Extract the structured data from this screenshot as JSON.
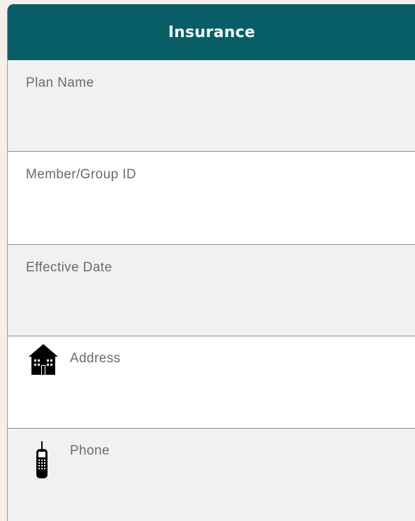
{
  "header": {
    "title": "Insurance"
  },
  "fields": [
    {
      "label": "Plan Name",
      "value": ""
    },
    {
      "label": "Member/Group ID",
      "value": ""
    },
    {
      "label": "Effective Date",
      "value": ""
    },
    {
      "label": "Address",
      "icon": "house-icon",
      "value": ""
    },
    {
      "label": "Phone",
      "icon": "cell-phone-icon",
      "value": ""
    }
  ],
  "colors": {
    "header_bg": "#075e67",
    "header_text": "#ffffff",
    "row_shade": "#f1f1f1",
    "label_text": "#6b6b6b",
    "page_bg": "#f5efec"
  }
}
